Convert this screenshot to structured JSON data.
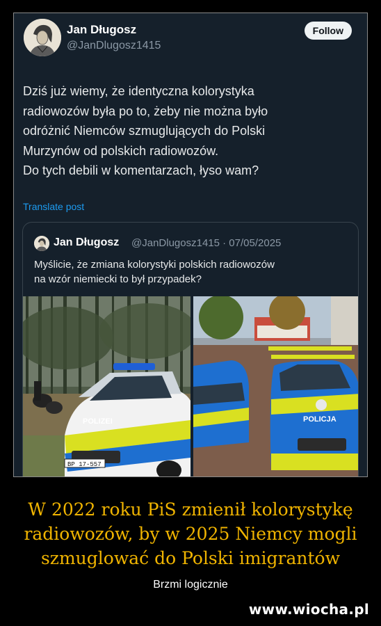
{
  "tweet": {
    "author_name": "Jan Długosz",
    "author_handle": "@JanDlugosz1415",
    "follow_label": "Follow",
    "text_lines": [
      "Dziś już wiemy, że identyczna kolorystyka",
      "radiowozów była po to, żeby nie można było",
      "odróżnić Niemców szmuglujących do Polski",
      "Murzynów od polskich radiowozów.",
      "Do tych debili w komentarzach, łyso wam?"
    ],
    "translate_label": "Translate post"
  },
  "quoted_tweet": {
    "author_name": "Jan Długosz",
    "meta": "@JanDlugosz1415 · 07/05/2025",
    "text_lines": [
      "Myślicie, że zmiana kolorystyki polskich radiowozów",
      "na wzór niemiecki to był przypadek?"
    ],
    "photo_left_labels": {
      "door_text": "POLIZEI",
      "plate": "BP 17-557"
    },
    "photo_right_labels": {
      "hood_text": "POLICJA"
    }
  },
  "caption": {
    "headline_lines": [
      "W 2022 roku PiS zmienił kolorystykę",
      "radiowozów, by w 2025 Niemcy mogli",
      "szmuglować do Polski imigrantów"
    ],
    "subline": "Brzmi logicznie",
    "watermark": "www.wiocha.pl"
  },
  "colors": {
    "page_background": "#000000",
    "tweet_background": "#15202b",
    "link_blue": "#1d9bf0",
    "headline_gold": "#f0b400",
    "police_yellow": "#d9e021",
    "police_blue": "#1e6fd0"
  },
  "icons": [
    "author-avatar-portrait",
    "quoted-author-avatar-portrait"
  ]
}
